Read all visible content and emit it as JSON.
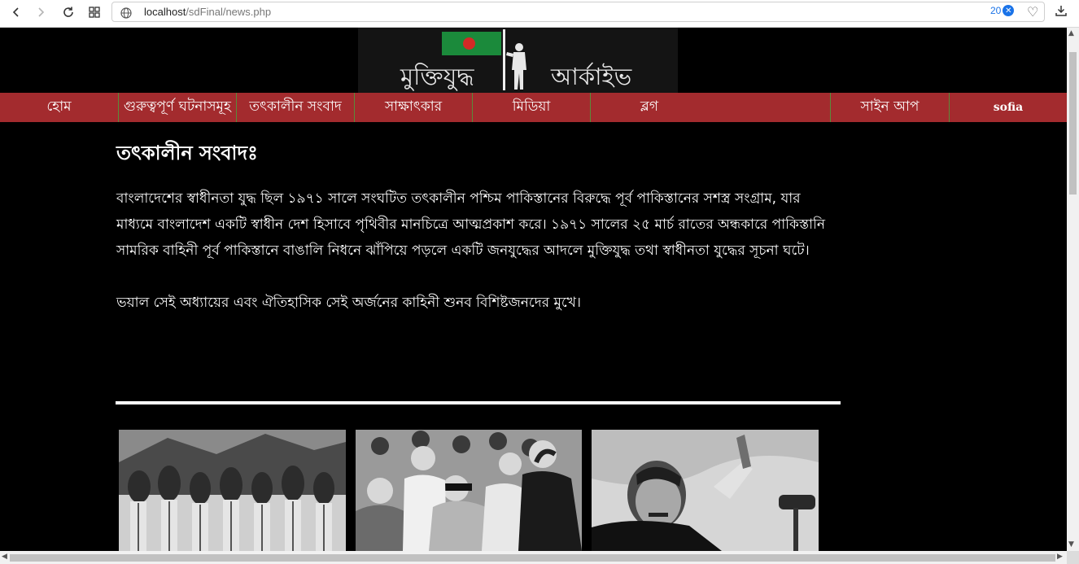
{
  "browser": {
    "url_host": "localhost",
    "url_path": "/sdFinal/news.php",
    "badge_count": "20",
    "icons": [
      "back-arrow-icon",
      "forward-arrow-icon",
      "reload-icon",
      "grid-icon",
      "globe-icon",
      "close-icon",
      "heart-icon",
      "download-icon"
    ]
  },
  "site": {
    "logo_text_left": "মুক্তিযুদ্ধ",
    "logo_text_right": "আর্কাইভ",
    "flag_colors": {
      "field": "#1b8a3b",
      "disc": "#d42a26"
    },
    "menu_color": "#a32b2e",
    "menu": [
      {
        "label": "হোম"
      },
      {
        "label": "গুরুত্বপূর্ণ ঘটনাসমূহ"
      },
      {
        "label": "তৎকালীন সংবাদ"
      },
      {
        "label": "সাক্ষাৎকার"
      },
      {
        "label": "মিডিয়া"
      },
      {
        "label": "ব্লগ"
      },
      {
        "label": ""
      },
      {
        "label": "সাইন আপ"
      },
      {
        "label": "sofia"
      }
    ]
  },
  "main": {
    "title": "তৎকালীন সংবাদঃ",
    "paragraph1": "বাংলাদেশের স্বাধীনতা যুদ্ধ ছিল ১৯৭১ সালে সংঘটিত তৎকালীন পশ্চিম পাকিস্তানের বিরুদ্ধে পূর্ব পাকিস্তানের সশস্ত্র সংগ্রাম, যার মাধ্যমে বাংলাদেশ একটি স্বাধীন দেশ হিসাবে পৃথিবীর মানচিত্রে আত্মপ্রকাশ করে। ১৯৭১ সালের ২৫ মার্চ রাতের অন্ধকারে পাকিস্তানি সামরিক বাহিনী পূর্ব পাকিস্তানে বাঙালি নিধনে ঝাঁপিয়ে পড়লে একটি জনযুদ্ধের আদলে মুক্তিযুদ্ধ তথা স্বাধীনতা যুদ্ধের সূচনা ঘটে।",
    "paragraph2": "ভয়াল সেই অধ্যায়ের এবং ঐতিহাসিক সেই অর্জনের কাহিনী শুনব বিশিষ্টজনদের মুখে।",
    "photos": [
      {
        "name": "photo-soldiers"
      },
      {
        "name": "photo-leaders-group"
      },
      {
        "name": "photo-speech"
      }
    ]
  }
}
